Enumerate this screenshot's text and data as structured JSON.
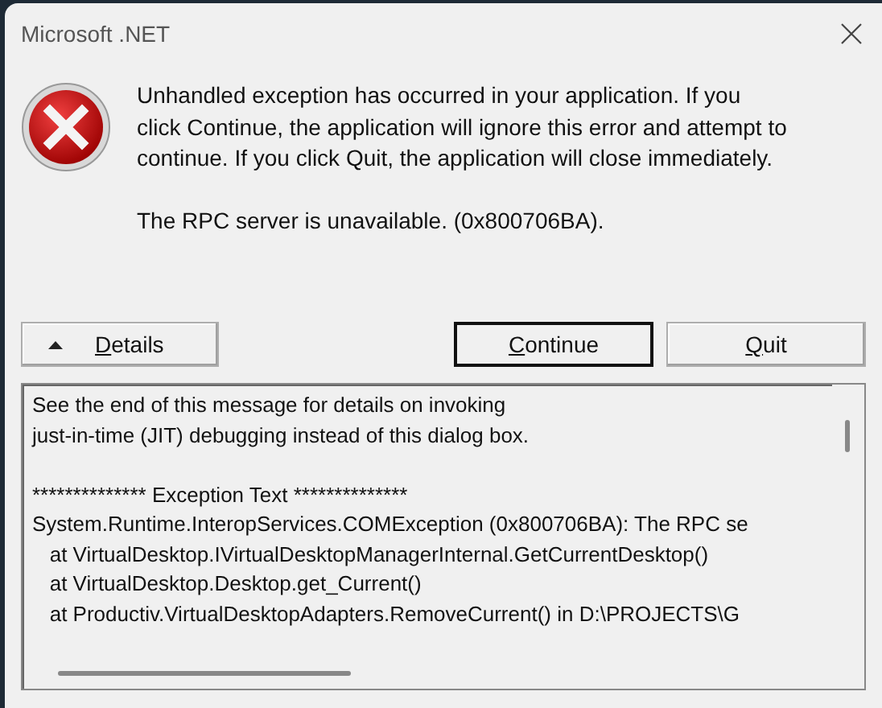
{
  "window": {
    "title": "Microsoft .NET"
  },
  "message": [
    "Unhandled exception has occurred in your application. If you click Continue, the application will ignore this error and attempt to continue. If you click Quit, the application will close immediately.",
    "The RPC server is unavailable. (0x800706BA)."
  ],
  "buttons": [
    {
      "label": "Details",
      "kind": "expander",
      "expanded": true
    },
    {
      "label": "Continue",
      "kind": "push",
      "default": true
    },
    {
      "label": "Quit",
      "kind": "push",
      "default": false
    }
  ],
  "details": {
    "paragraphs": [
      [
        "See the end of this message for details on invoking",
        "just-in-time (JIT) debugging instead of this dialog box."
      ],
      [
        "************** Exception Text **************",
        "System.Runtime.InteropServices.COMException (0x800706BA): The RPC se",
        "   at VirtualDesktop.IVirtualDesktopManagerInternal.GetCurrentDesktop()",
        "   at VirtualDesktop.Desktop.get_Current()",
        "   at Productiv.VirtualDesktopAdapters.RemoveCurrent() in D:\\PROJECTS\\G"
      ]
    ]
  }
}
